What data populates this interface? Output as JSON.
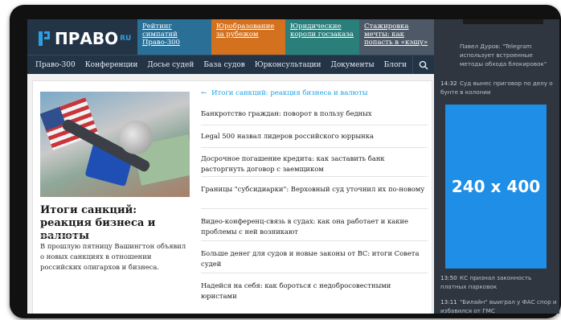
{
  "logo": {
    "text": "ПРАВО",
    "suffix": "RU"
  },
  "promos": [
    {
      "label": "Рейтинг симпатий Право-300"
    },
    {
      "label": "Юробразование за рубежом"
    },
    {
      "label": "Юридические короли госзаказа"
    },
    {
      "label": "Стажировка мечты: как попасть в «кэшу»"
    }
  ],
  "nav": [
    "Право-300",
    "Конференции",
    "Досье судей",
    "База судов",
    "Юрконсультации",
    "Документы",
    "Блоги"
  ],
  "hero": {
    "title": "Итоги санкций: реакция бизнеса и валюты",
    "description": "В прошлую пятницу Вашингтон объявил о новых санкциях в отношении российских олигархов и бизнеса."
  },
  "list": {
    "heading": "Итоги санкций: реакция бизнеса и валюты",
    "items": [
      "Банкротство граждан: поворот в пользу бедных",
      "Legal 500 назвал лидеров российского юррынка",
      "Досрочное погашение кредита: как заставить банк расторгнуть договор с заемщиком",
      "Границы \"субсидиарки\": Верховный суд уточнил их по-новому",
      "Видео-конференц-связь в судах: как она работает и какие проблемы с ней возникают",
      "Больше денег для судов и новые законы от ВС: итоги Совета судей",
      "Надейся на себя: как бороться с недобросовестными юристами"
    ]
  },
  "side": {
    "news_top": "Павел Дуров: \"Telegram использует встроенные методы обхода блокировок\"",
    "news": [
      {
        "time": "14:32",
        "text": "Суд вынес приговор по делу о бунте в колонии"
      },
      {
        "time": "13:50",
        "text": "КС признал законность платных парковок"
      },
      {
        "time": "13:11",
        "text": "\"Билайн\" выиграл у ФАС спор и избавился от ГМС"
      }
    ],
    "ad": "240 x 400"
  },
  "colors": {
    "accent": "#1da1e6",
    "header": "#243447",
    "sidebar": "#2f3640",
    "ad": "#1e8ee6"
  }
}
